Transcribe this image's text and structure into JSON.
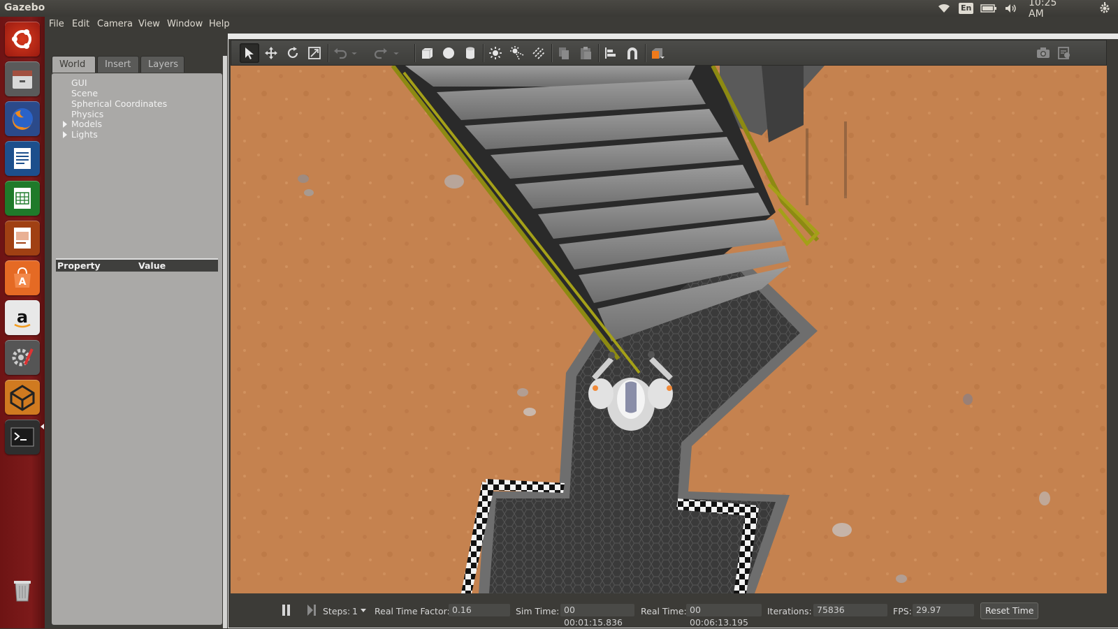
{
  "topbar": {
    "app_title": "Gazebo",
    "keyboard_layout": "En",
    "clock": "10:25 AM",
    "icons": [
      "wifi-icon",
      "keyboard-layout-indicator",
      "battery-icon",
      "volume-icon",
      "settings-gear-icon"
    ]
  },
  "launcher": {
    "items": [
      "ubuntu-dash-icon",
      "files-icon",
      "firefox-icon",
      "writer-icon",
      "calc-icon",
      "impress-icon",
      "software-center-icon",
      "amazon-icon",
      "system-settings-icon",
      "gazebo-icon",
      "terminal-icon",
      "trash-icon"
    ]
  },
  "menubar": {
    "file": "File",
    "edit": "Edit",
    "camera": "Camera",
    "view": "View",
    "window": "Window",
    "help": "Help"
  },
  "left_panel": {
    "tabs": {
      "world": "World",
      "insert": "Insert",
      "layers": "Layers"
    },
    "tree": {
      "gui": "GUI",
      "scene": "Scene",
      "spherical": "Spherical Coordinates",
      "physics": "Physics",
      "models": "Models",
      "lights": "Lights"
    },
    "property_header": "Property",
    "value_header": "Value"
  },
  "toolbar": {
    "tools": [
      "select-mode-icon",
      "translate-mode-icon",
      "rotate-mode-icon",
      "scale-mode-icon",
      "undo-icon",
      "undo-history-icon",
      "redo-icon",
      "redo-history-icon",
      "box-shape-icon",
      "sphere-shape-icon",
      "cylinder-shape-icon",
      "point-light-icon",
      "spot-light-icon",
      "directional-light-icon",
      "copy-icon",
      "paste-icon",
      "align-icon",
      "snap-icon",
      "view-angle-icon",
      "screenshot-icon",
      "log-icon"
    ]
  },
  "bottom_bar": {
    "steps_label": "Steps:",
    "steps_value": "1",
    "rtf_label": "Real Time Factor:",
    "rtf_value": "0.16",
    "sim_time_label": "Sim Time:",
    "sim_time_value": "00 00:01:15.836",
    "real_time_label": "Real Time:",
    "real_time_value": "00 00:06:13.195",
    "iterations_label": "Iterations:",
    "iterations_value": "75836",
    "fps_label": "FPS:",
    "fps_value": "29.97",
    "reset_time": "Reset Time"
  },
  "colors": {
    "ground": "#c8875a",
    "launcher": "#7d1a1a",
    "panel": "#3c3b37",
    "tree_bg": "#aaa9a7",
    "stair_rail": "#9a9a1a"
  }
}
